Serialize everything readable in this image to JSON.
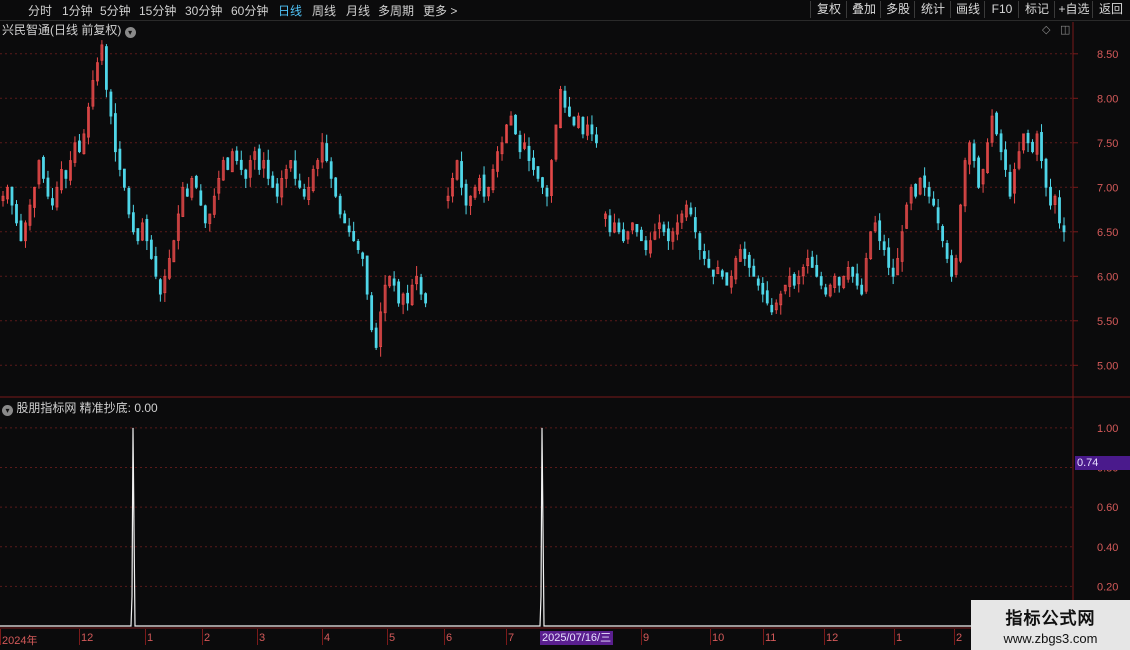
{
  "toolbar": {
    "periods": [
      "分时",
      "1分钟",
      "5分钟",
      "15分钟",
      "30分钟",
      "60分钟",
      "日线",
      "周线",
      "月线",
      "多周期",
      "更多 >"
    ],
    "active_period": "日线",
    "buttons": [
      "复权",
      "叠加",
      "多股",
      "统计",
      "画线",
      "F10",
      "标记",
      "+自选",
      "返回"
    ]
  },
  "chart_title": "兴民智通(日线 前复权)",
  "indicator_title": "股朋指标网 精准抄底: 0.00",
  "price_axis": [
    "8.50",
    "8.00",
    "7.50",
    "7.00",
    "6.50",
    "6.00",
    "5.50",
    "5.00"
  ],
  "indicator_axis": [
    "1.00",
    "0.80",
    "0.60",
    "0.40",
    "0.20"
  ],
  "date_axis": [
    "2024年",
    "12",
    "1",
    "2",
    "3",
    "4",
    "5",
    "6",
    "7",
    "9",
    "10",
    "11",
    "12",
    "1",
    "2"
  ],
  "cursor": {
    "date": "2025/07/16/三",
    "value": "0.74"
  },
  "watermark": {
    "line1": "指标公式网",
    "line2": "www.zbgs3.com"
  },
  "colors": {
    "up": "#e84a4a",
    "down": "#4fd6e8",
    "axis_label": "#d45a5a",
    "grid": "#5a1a1a",
    "cursor": "#5a1f8f"
  },
  "chart_data": {
    "type": "candlestick",
    "title": "兴民智通(日线 前复权)",
    "ylim": [
      4.7,
      8.7
    ],
    "y_ticks": [
      5.0,
      5.5,
      6.0,
      6.5,
      7.0,
      7.5,
      8.0,
      8.5
    ],
    "close": [
      6.9,
      7.0,
      6.8,
      6.6,
      6.4,
      6.6,
      6.8,
      7.0,
      7.3,
      7.1,
      6.9,
      6.8,
      7.0,
      7.2,
      7.1,
      7.3,
      7.5,
      7.4,
      7.6,
      7.9,
      8.2,
      8.4,
      8.6,
      8.1,
      7.8,
      7.4,
      7.2,
      7.0,
      6.7,
      6.5,
      6.4,
      6.6,
      6.4,
      6.2,
      6.0,
      5.8,
      6.0,
      6.2,
      6.4,
      6.7,
      7.0,
      6.9,
      7.1,
      7.0,
      6.8,
      6.6,
      6.7,
      6.9,
      7.1,
      7.3,
      7.2,
      7.4,
      7.3,
      7.2,
      7.1,
      7.3,
      7.4,
      7.2,
      7.3,
      7.1,
      7.0,
      6.9,
      7.1,
      7.2,
      7.3,
      7.1,
      7.0,
      6.9,
      7.0,
      7.2,
      7.3,
      7.5,
      7.3,
      7.1,
      6.9,
      6.7,
      6.6,
      6.5,
      6.4,
      6.3,
      6.2,
      5.8,
      5.4,
      5.2,
      5.6,
      5.9,
      6.0,
      5.9,
      5.7,
      5.8,
      5.7,
      5.9,
      6.0,
      5.8,
      5.7,
      null,
      null,
      null,
      null,
      6.9,
      7.1,
      7.3,
      7.0,
      6.8,
      6.9,
      7.0,
      7.1,
      6.9,
      7.0,
      7.2,
      7.4,
      7.5,
      7.7,
      7.8,
      7.6,
      7.4,
      7.5,
      7.3,
      7.2,
      7.1,
      7.0,
      6.9,
      7.3,
      7.7,
      8.1,
      7.9,
      7.8,
      7.7,
      7.8,
      7.6,
      7.7,
      7.6,
      7.5,
      null,
      6.7,
      6.5,
      6.6,
      6.5,
      6.4,
      6.5,
      6.6,
      6.5,
      6.4,
      6.3,
      6.4,
      6.5,
      6.6,
      6.5,
      6.4,
      6.5,
      6.6,
      6.7,
      6.8,
      6.7,
      6.5,
      6.3,
      6.2,
      6.1,
      6.0,
      6.1,
      6.0,
      5.9,
      6.0,
      6.2,
      6.3,
      6.2,
      6.1,
      6.0,
      5.9,
      5.8,
      5.7,
      5.6,
      5.7,
      5.8,
      5.9,
      6.0,
      5.9,
      6.0,
      6.1,
      6.2,
      6.1,
      6.0,
      5.9,
      5.8,
      5.9,
      6.0,
      5.9,
      6.0,
      6.1,
      6.0,
      5.9,
      5.8,
      6.2,
      6.5,
      6.6,
      6.4,
      6.3,
      6.1,
      6.0,
      6.2,
      6.5,
      6.8,
      7.0,
      6.9,
      7.1,
      7.0,
      6.9,
      6.8,
      6.6,
      6.4,
      6.2,
      6.0,
      6.2,
      6.8,
      7.3,
      7.5,
      7.3,
      7.0,
      7.2,
      7.5,
      7.8,
      7.6,
      7.4,
      7.2,
      6.9,
      7.2,
      7.4,
      7.6,
      7.5,
      7.4,
      7.6,
      7.3,
      7.0,
      6.8,
      6.9,
      6.6,
      6.5
    ],
    "indicator": {
      "name": "精准抄底",
      "current": 0.0,
      "spikes": [
        1.0,
        1.0
      ],
      "ylim": [
        0,
        1.05
      ]
    }
  }
}
